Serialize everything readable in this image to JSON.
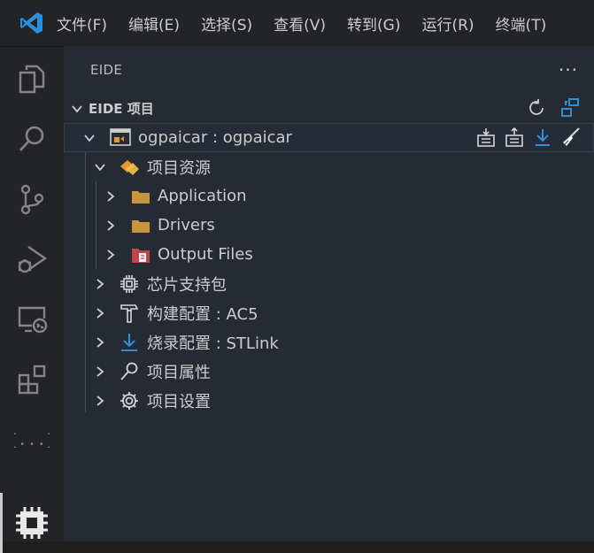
{
  "menubar": {
    "items": [
      "文件(F)",
      "编辑(E)",
      "选择(S)",
      "查看(V)",
      "转到(G)",
      "运行(R)",
      "终端(T)"
    ]
  },
  "activitybar": {
    "icons": [
      "explorer-icon",
      "search-icon",
      "source-control-icon",
      "run-debug-icon",
      "remote-explorer-icon",
      "extensions-icon",
      "json-icon",
      "eide-chip-icon"
    ]
  },
  "sidebar": {
    "title": "EIDE",
    "more_label": "···",
    "section": {
      "title": "EIDE 项目",
      "actions": [
        "refresh-icon",
        "switch-project-icon"
      ]
    },
    "project": {
      "name": "ogpaicar : ogpaicar",
      "actions": [
        "build-icon",
        "rebuild-icon",
        "flash-download-icon",
        "clean-icon"
      ]
    },
    "tree": {
      "resources": "项目资源",
      "application": "Application",
      "drivers": "Drivers",
      "output": "Output Files",
      "pack": "芯片支持包",
      "build": "构建配置 : AC5",
      "flash": "烧录配置 : STLink",
      "props": "项目属性",
      "settings": "项目设置"
    }
  },
  "colors": {
    "accent": "#2b8fe0",
    "folder": "#c8963e",
    "output_folder": "#c0444a",
    "resources_orange": "#e69a2c"
  }
}
